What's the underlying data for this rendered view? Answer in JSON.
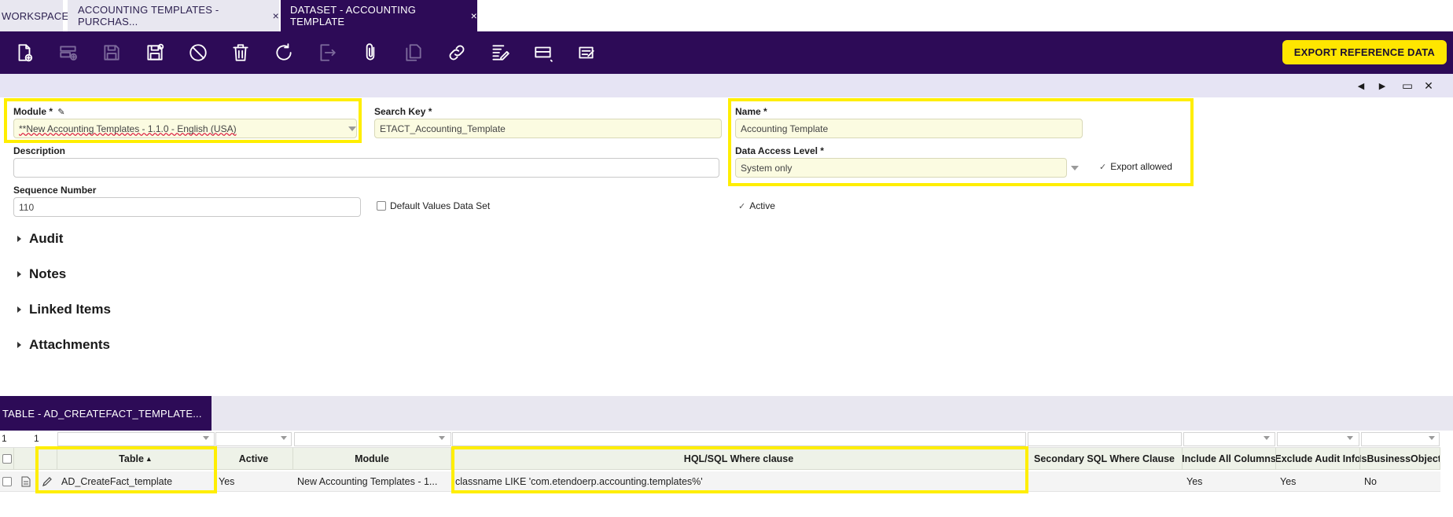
{
  "tabs": [
    {
      "label": "WORKSPACE",
      "state": "inactive"
    },
    {
      "label": "ACCOUNTING TEMPLATES - PURCHAS...",
      "state": "inactive",
      "close": "×"
    },
    {
      "label": "DATASET - ACCOUNTING TEMPLATE",
      "state": "active",
      "close": "×"
    }
  ],
  "toolbar": {
    "buttons": [
      {
        "icon": "new-document-icon",
        "enabled": true
      },
      {
        "icon": "new-row-icon",
        "enabled": false
      },
      {
        "icon": "save-icon",
        "enabled": false
      },
      {
        "icon": "save-close-icon",
        "enabled": true
      },
      {
        "icon": "cancel-icon",
        "enabled": true
      },
      {
        "icon": "delete-icon",
        "enabled": true
      },
      {
        "icon": "refresh-icon",
        "enabled": true
      },
      {
        "icon": "export-icon",
        "enabled": false
      },
      {
        "icon": "attachment-icon",
        "enabled": true
      },
      {
        "icon": "clone-icon",
        "enabled": false
      },
      {
        "icon": "link-icon",
        "enabled": true
      },
      {
        "icon": "audit-trail-icon",
        "enabled": true
      },
      {
        "icon": "grid-view-icon",
        "enabled": true
      },
      {
        "icon": "notes-icon",
        "enabled": true
      }
    ],
    "export_label": "EXPORT REFERENCE DATA"
  },
  "nav": {
    "prev": "◀",
    "next": "▶",
    "maximize": "▭",
    "close": "✕"
  },
  "form": {
    "module_label": "Module *",
    "module_value": "**New Accounting Templates - 1.1.0 - English (USA)",
    "search_key_label": "Search Key *",
    "search_key_value": "ETACT_Accounting_Template",
    "name_label": "Name *",
    "name_value": "Accounting Template",
    "description_label": "Description",
    "description_value": "",
    "data_access_label": "Data Access Level *",
    "data_access_value": "System only",
    "export_allowed_label": "Export allowed",
    "sequence_label": "Sequence Number",
    "sequence_value": "110",
    "default_values_label": "Default Values Data Set",
    "active_label": "Active"
  },
  "sections": [
    "Audit",
    "Notes",
    "Linked Items",
    "Attachments"
  ],
  "subtab": {
    "label": "TABLE - AD_CREATEFACT_TEMPLATE..."
  },
  "grid": {
    "filter_row": {
      "count_a": "1",
      "count_b": "1"
    },
    "columns": [
      "Table",
      "Active",
      "Module",
      "HQL/SQL Where clause",
      "Secondary SQL Where Clause",
      "Include All Columns",
      "Exclude Audit Info",
      "IsBusinessObject"
    ],
    "sort_indicator": "▲",
    "rows": [
      [
        "AD_CreateFact_template",
        "Yes",
        "New Accounting Templates - 1...",
        "classname LIKE 'com.etendoerp.accounting.templates%'",
        "",
        "Yes",
        "Yes",
        "No"
      ]
    ]
  },
  "colors": {
    "primary": "#2d0b57",
    "accent": "#ffe600",
    "highlight": "#ffee00",
    "required_bg": "#fbfbe1"
  }
}
